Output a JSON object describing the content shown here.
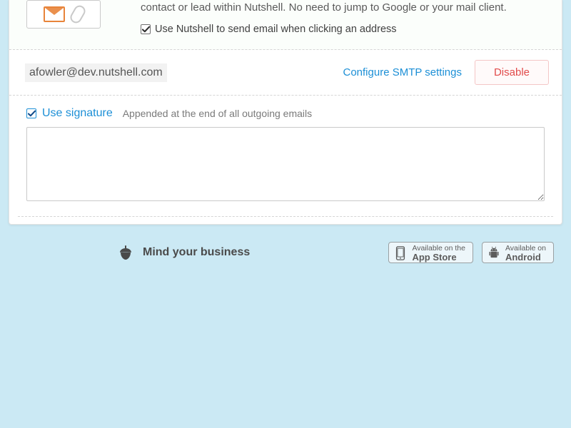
{
  "top": {
    "desc": "contact or lead within Nutshell. No need to jump to Google or your mail client.",
    "checkbox_label": "Use Nutshell to send email when clicking an address"
  },
  "smtp": {
    "email": "afowler@dev.nutshell.com",
    "configure_label": "Configure SMTP settings",
    "disable_label": "Disable"
  },
  "signature": {
    "label": "Use signature",
    "desc": "Appended at the end of all outgoing emails",
    "value": ""
  },
  "footer": {
    "tagline": "Mind your business",
    "badges": [
      {
        "line1": "Available on the",
        "line2": "App Store"
      },
      {
        "line1": "Available on",
        "line2": "Android"
      }
    ]
  }
}
